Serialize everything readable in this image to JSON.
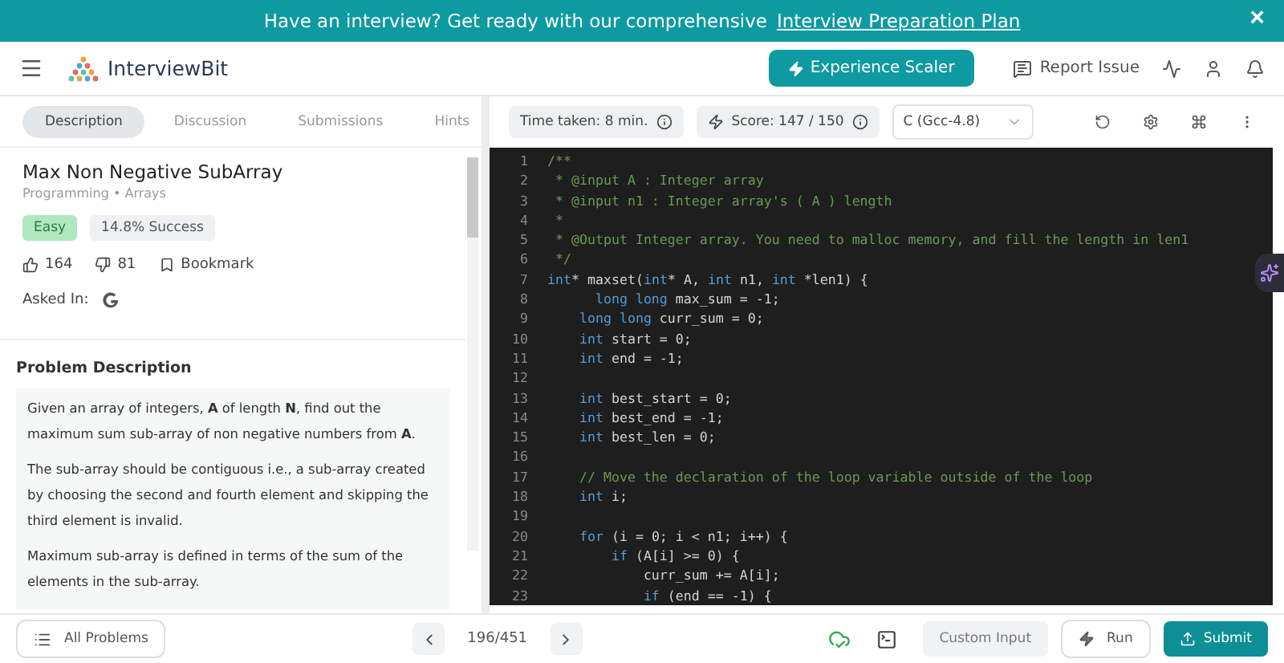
{
  "banner": {
    "text": "Have an interview? Get ready with our comprehensive",
    "link": "Interview Preparation Plan",
    "close": "×"
  },
  "header": {
    "logo": "InterviewBit",
    "cta": "Experience Scaler",
    "report": "Report Issue"
  },
  "tabs": [
    {
      "label": "Description",
      "selected": true
    },
    {
      "label": "Discussion",
      "selected": false
    },
    {
      "label": "Submissions",
      "selected": false
    },
    {
      "label": "Hints",
      "selected": false
    }
  ],
  "problem": {
    "title": "Max Non Negative SubArray",
    "breadcrumb": [
      "Programming",
      "•",
      "Arrays"
    ],
    "difficulty": "Easy",
    "success": "14.8% Success",
    "likes": "164",
    "dislikes": "81",
    "bookmark": "Bookmark",
    "asked_in": "Asked In:",
    "section": "Problem Description",
    "paragraphs": [
      "Given an array of integers, **A** of length **N**, find out the maximum sum sub-array of non negative numbers from **A**.",
      "The sub-array should be contiguous i.e., a sub-array created by choosing the second and fourth element and skipping the third element is invalid.",
      "Maximum sub-array is defined in terms of the sum of the elements in the sub-array."
    ]
  },
  "editor": {
    "time": "Time taken: 8 min.",
    "score": "Score: 147 / 150",
    "language": "C (Gcc-4.8)",
    "lines": [
      {
        "number": "1",
        "tokens": [
          {
            "kind": "comment",
            "text": "/**"
          }
        ]
      },
      {
        "number": "2",
        "tokens": [
          {
            "kind": "comment",
            "text": " * @input A : Integer array"
          }
        ]
      },
      {
        "number": "3",
        "tokens": [
          {
            "kind": "comment",
            "text": " * @input n1 : Integer array's ( A ) length"
          }
        ]
      },
      {
        "number": "4",
        "tokens": [
          {
            "kind": "comment",
            "text": " *"
          }
        ]
      },
      {
        "number": "5",
        "tokens": [
          {
            "kind": "comment",
            "text": " * @Output Integer array. You need to malloc memory, and fill the length in len1"
          }
        ]
      },
      {
        "number": "6",
        "tokens": [
          {
            "kind": "comment",
            "text": " */"
          }
        ]
      },
      {
        "number": "7",
        "tokens": [
          {
            "kind": "keyword",
            "text": "int"
          },
          {
            "kind": "plain",
            "text": "* maxset("
          },
          {
            "kind": "keyword",
            "text": "int"
          },
          {
            "kind": "plain",
            "text": "* A, "
          },
          {
            "kind": "keyword",
            "text": "int"
          },
          {
            "kind": "plain",
            "text": " n1, "
          },
          {
            "kind": "keyword",
            "text": "int"
          },
          {
            "kind": "plain",
            "text": " *len1) {"
          }
        ]
      },
      {
        "number": "8",
        "tokens": [
          {
            "kind": "keyword",
            "text": "      long long"
          },
          {
            "kind": "plain",
            "text": " max_sum = -1;"
          }
        ]
      },
      {
        "number": "9",
        "tokens": [
          {
            "kind": "keyword",
            "text": "    long long"
          },
          {
            "kind": "plain",
            "text": " curr_sum = 0;"
          }
        ]
      },
      {
        "number": "10",
        "tokens": [
          {
            "kind": "keyword",
            "text": "    int"
          },
          {
            "kind": "plain",
            "text": " start = 0;"
          }
        ]
      },
      {
        "number": "11",
        "tokens": [
          {
            "kind": "keyword",
            "text": "    int"
          },
          {
            "kind": "plain",
            "text": " end = -1;"
          }
        ]
      },
      {
        "number": "12"
      },
      {
        "number": "13",
        "tokens": [
          {
            "kind": "keyword",
            "text": "    int"
          },
          {
            "kind": "plain",
            "text": " best_start = 0;"
          }
        ]
      },
      {
        "number": "14",
        "tokens": [
          {
            "kind": "keyword",
            "text": "    int"
          },
          {
            "kind": "plain",
            "text": " best_end = -1;"
          }
        ]
      },
      {
        "number": "15",
        "tokens": [
          {
            "kind": "keyword",
            "text": "    int"
          },
          {
            "kind": "plain",
            "text": " best_len = 0;"
          }
        ]
      },
      {
        "number": "16"
      },
      {
        "number": "17",
        "tokens": [
          {
            "kind": "comment",
            "text": "    // Move the declaration of the loop variable outside of the loop"
          }
        ]
      },
      {
        "number": "18",
        "tokens": [
          {
            "kind": "keyword",
            "text": "    int"
          },
          {
            "kind": "plain",
            "text": " i;"
          }
        ]
      },
      {
        "number": "19"
      },
      {
        "number": "20",
        "tokens": [
          {
            "kind": "keyword",
            "text": "    for"
          },
          {
            "kind": "plain",
            "text": " (i = 0; i < n1; i++) {"
          }
        ]
      },
      {
        "number": "21",
        "tokens": [
          {
            "kind": "keyword",
            "text": "        if"
          },
          {
            "kind": "plain",
            "text": " (A[i] >= 0) {"
          }
        ]
      },
      {
        "number": "22",
        "tokens": [
          {
            "kind": "plain",
            "text": "            curr_sum += A[i];"
          }
        ]
      },
      {
        "number": "23",
        "tokens": [
          {
            "kind": "keyword",
            "text": "            if"
          },
          {
            "kind": "plain",
            "text": " (end == -1) {"
          }
        ]
      }
    ]
  },
  "footer": {
    "all_problems": "All Problems",
    "position": "196/451",
    "custom_input": "Custom Input",
    "run": "Run",
    "submit": "Submit"
  }
}
